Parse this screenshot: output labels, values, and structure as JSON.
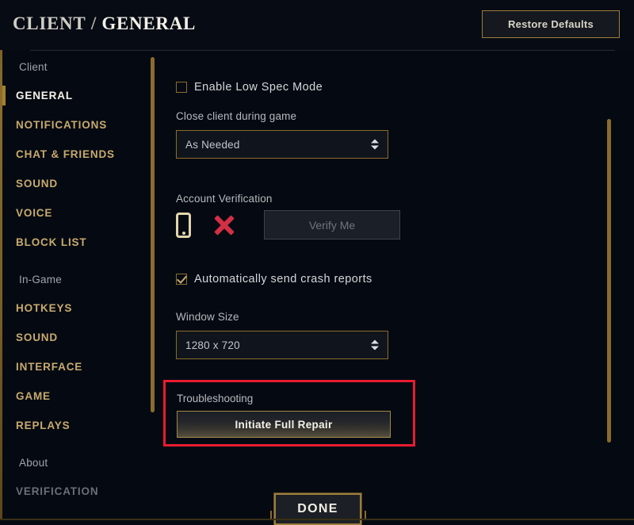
{
  "header": {
    "breadcrumb_root": "CLIENT",
    "breadcrumb_separator": "/",
    "breadcrumb_current": "GENERAL",
    "restore_defaults_label": "Restore Defaults"
  },
  "sidebar": {
    "groups": [
      {
        "header": "Client",
        "items": [
          {
            "label": "GENERAL",
            "state": "active"
          },
          {
            "label": "NOTIFICATIONS",
            "state": "normal"
          },
          {
            "label": "CHAT & FRIENDS",
            "state": "normal"
          },
          {
            "label": "SOUND",
            "state": "normal"
          },
          {
            "label": "VOICE",
            "state": "normal"
          },
          {
            "label": "BLOCK LIST",
            "state": "normal"
          }
        ]
      },
      {
        "header": "In-Game",
        "items": [
          {
            "label": "HOTKEYS",
            "state": "normal"
          },
          {
            "label": "SOUND",
            "state": "normal"
          },
          {
            "label": "INTERFACE",
            "state": "normal"
          },
          {
            "label": "GAME",
            "state": "normal"
          },
          {
            "label": "REPLAYS",
            "state": "normal"
          }
        ]
      },
      {
        "header": "About",
        "items": [
          {
            "label": "VERIFICATION",
            "state": "dim"
          }
        ]
      }
    ]
  },
  "main": {
    "low_spec": {
      "label": "Enable Low Spec Mode",
      "checked": false
    },
    "close_client": {
      "label": "Close client during game",
      "value": "As Needed"
    },
    "account_verification": {
      "label": "Account Verification",
      "phone_icon": "mobile-phone-icon",
      "status_icon": "red-x-icon",
      "verify_button_label": "Verify Me",
      "verify_button_enabled": false
    },
    "crash_reports": {
      "label": "Automatically send crash reports",
      "checked": true
    },
    "window_size": {
      "label": "Window Size",
      "value": "1280 x 720"
    },
    "troubleshooting": {
      "label": "Troubleshooting",
      "repair_button_label": "Initiate Full Repair",
      "highlight_color": "#e81c30"
    }
  },
  "footer": {
    "done_label": "DONE"
  },
  "colors": {
    "background": "#050a12",
    "gold": "#c8aa6e",
    "gold_border": "#8a6c2c",
    "text_primary": "#d4d7da",
    "text_muted": "#b6b9bd",
    "accent_red": "#e81c30"
  }
}
